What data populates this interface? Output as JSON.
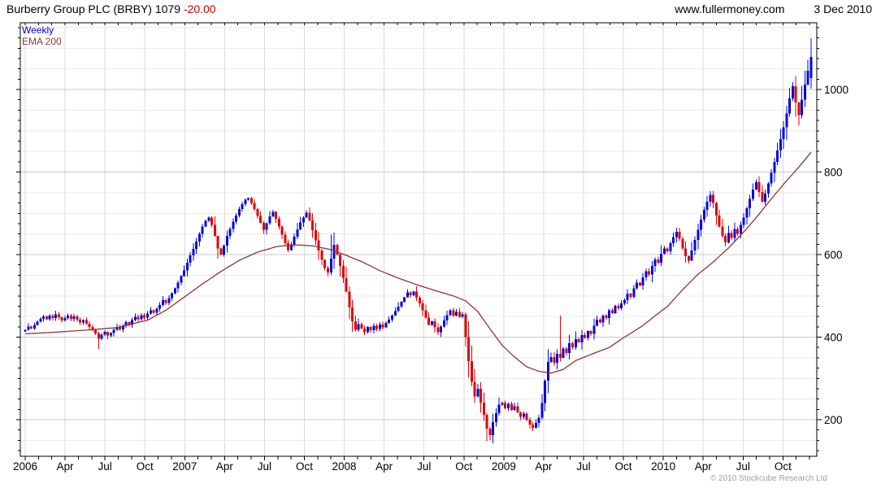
{
  "header": {
    "title": "Burberry Group PLC (BRBY) 1079 ",
    "change": "-20.00",
    "site": "www.fullermoney.com",
    "date": "3 Dec 2010"
  },
  "legend": {
    "series1": "Weekly",
    "series2": "EMA 200"
  },
  "footer": {
    "copyright": "© 2010 Stockcube Research Ltd"
  },
  "chart_data": {
    "type": "candlestick",
    "title": "Burberry Group PLC (BRBY) weekly candles with 200-day EMA, Jan 2006 - Dec 2010",
    "last_price": 1079,
    "last_change": -20.0,
    "x_axis": {
      "labels": [
        "2006",
        "Apr",
        "Jul",
        "Oct",
        "2007",
        "Apr",
        "Jul",
        "Oct",
        "2008",
        "Apr",
        "Jul",
        "Oct",
        "2009",
        "Apr",
        "Jul",
        "Oct",
        "2010",
        "Apr",
        "Jul",
        "Oct"
      ],
      "months_total": 60
    },
    "y_axis": {
      "ticks": [
        200,
        400,
        600,
        800,
        1000
      ],
      "minor_tick_step": 25,
      "grid_step": 50,
      "ylim": [
        110,
        1165
      ]
    },
    "colors": {
      "up": "#0008dd",
      "down": "#e00000",
      "ema": "#8f3434",
      "grid_minor": "#eaeaea",
      "grid_major": "#c8c8c8",
      "grid_vertical": "#dadada",
      "axis": "#000000",
      "change_text": "#cc0000"
    },
    "series": {
      "weekly": {
        "name": "Weekly",
        "first_open": 414,
        "closes": [
          418,
          426,
          421,
          430,
          437,
          444,
          450,
          443,
          452,
          446,
          455,
          448,
          440,
          446,
          452,
          444,
          450,
          442,
          435,
          441,
          433,
          425,
          417,
          409,
          396,
          406,
          413,
          404,
          410,
          418,
          425,
          419,
          428,
          436,
          430,
          441,
          449,
          443,
          453,
          447,
          457,
          465,
          459,
          469,
          478,
          490,
          483,
          495,
          506,
          518,
          532,
          548,
          562,
          580,
          598,
          614,
          632,
          650,
          668,
          682,
          690,
          672,
          645,
          615,
          600,
          622,
          645,
          662,
          680,
          695,
          710,
          722,
          733,
          737,
          725,
          710,
          694,
          677,
          660,
          676,
          693,
          703,
          687,
          668,
          648,
          628,
          611,
          625,
          643,
          661,
          678,
          690,
          701,
          683,
          659,
          634,
          610,
          587,
          567,
          557,
          590,
          624,
          600,
          572,
          543,
          510,
          472,
          438,
          418,
          432,
          421,
          412,
          425,
          417,
          428,
          420,
          431,
          424,
          434,
          442,
          452,
          463,
          474,
          486,
          497,
          508,
          501,
          510,
          496,
          482,
          465,
          447,
          430,
          438,
          424,
          412,
          426,
          440,
          453,
          465,
          452,
          461,
          449,
          455,
          400,
          342,
          292,
          256,
          275,
          241,
          212,
          178,
          163,
          194,
          216,
          236,
          240,
          228,
          238,
          224,
          233,
          218,
          207,
          215,
          200,
          188,
          180,
          192,
          205,
          240,
          295,
          340,
          352,
          338,
          360,
          350,
          372,
          362,
          385,
          375,
          395,
          387,
          405,
          398,
          415,
          408,
          428,
          442,
          435,
          452,
          446,
          465,
          458,
          476,
          470,
          482,
          490,
          505,
          498,
          518,
          532,
          525,
          545,
          560,
          552,
          572,
          588,
          580,
          602,
          615,
          608,
          628,
          642,
          655,
          638,
          615,
          596,
          585,
          610,
          635,
          660,
          685,
          708,
          728,
          745,
          725,
          695,
          668,
          645,
          630,
          652,
          640,
          662,
          650,
          672,
          690,
          712,
          735,
          758,
          775,
          752,
          728,
          748,
          772,
          798,
          825,
          852,
          880,
          908,
          942,
          978,
          1008,
          968,
          938,
          975,
          1012,
          1045,
          1079
        ],
        "overrides": {
          "24": [
            409,
            413,
            371,
            396
          ],
          "100": [
            557,
            648,
            551,
            590
          ],
          "151": [
            212,
            216,
            148,
            178
          ],
          "152": [
            178,
            183,
            150,
            163
          ],
          "175": [
            360,
            452,
            341,
            350
          ],
          "257": [
            1028,
            1124,
            1002,
            1079
          ]
        }
      },
      "ema200": {
        "name": "EMA 200",
        "anchors": [
          [
            0,
            408
          ],
          [
            10,
            412
          ],
          [
            20,
            417
          ],
          [
            30,
            423
          ],
          [
            40,
            441
          ],
          [
            46,
            465
          ],
          [
            52,
            497
          ],
          [
            58,
            529
          ],
          [
            64,
            559
          ],
          [
            70,
            586
          ],
          [
            76,
            606
          ],
          [
            82,
            619
          ],
          [
            88,
            624
          ],
          [
            94,
            621
          ],
          [
            100,
            612
          ],
          [
            104,
            601
          ],
          [
            110,
            583
          ],
          [
            116,
            561
          ],
          [
            122,
            543
          ],
          [
            128,
            527
          ],
          [
            134,
            513
          ],
          [
            140,
            500
          ],
          [
            144,
            488
          ],
          [
            148,
            462
          ],
          [
            152,
            420
          ],
          [
            156,
            380
          ],
          [
            160,
            352
          ],
          [
            164,
            328
          ],
          [
            168,
            317
          ],
          [
            172,
            313
          ],
          [
            176,
            322
          ],
          [
            180,
            343
          ],
          [
            185,
            358
          ],
          [
            191,
            375
          ],
          [
            196,
            400
          ],
          [
            202,
            428
          ],
          [
            206,
            452
          ],
          [
            210,
            474
          ],
          [
            215,
            515
          ],
          [
            220,
            552
          ],
          [
            225,
            582
          ],
          [
            230,
            616
          ],
          [
            235,
            655
          ],
          [
            239,
            689
          ],
          [
            244,
            735
          ],
          [
            249,
            779
          ],
          [
            253,
            812
          ],
          [
            257,
            848
          ]
        ]
      }
    }
  }
}
